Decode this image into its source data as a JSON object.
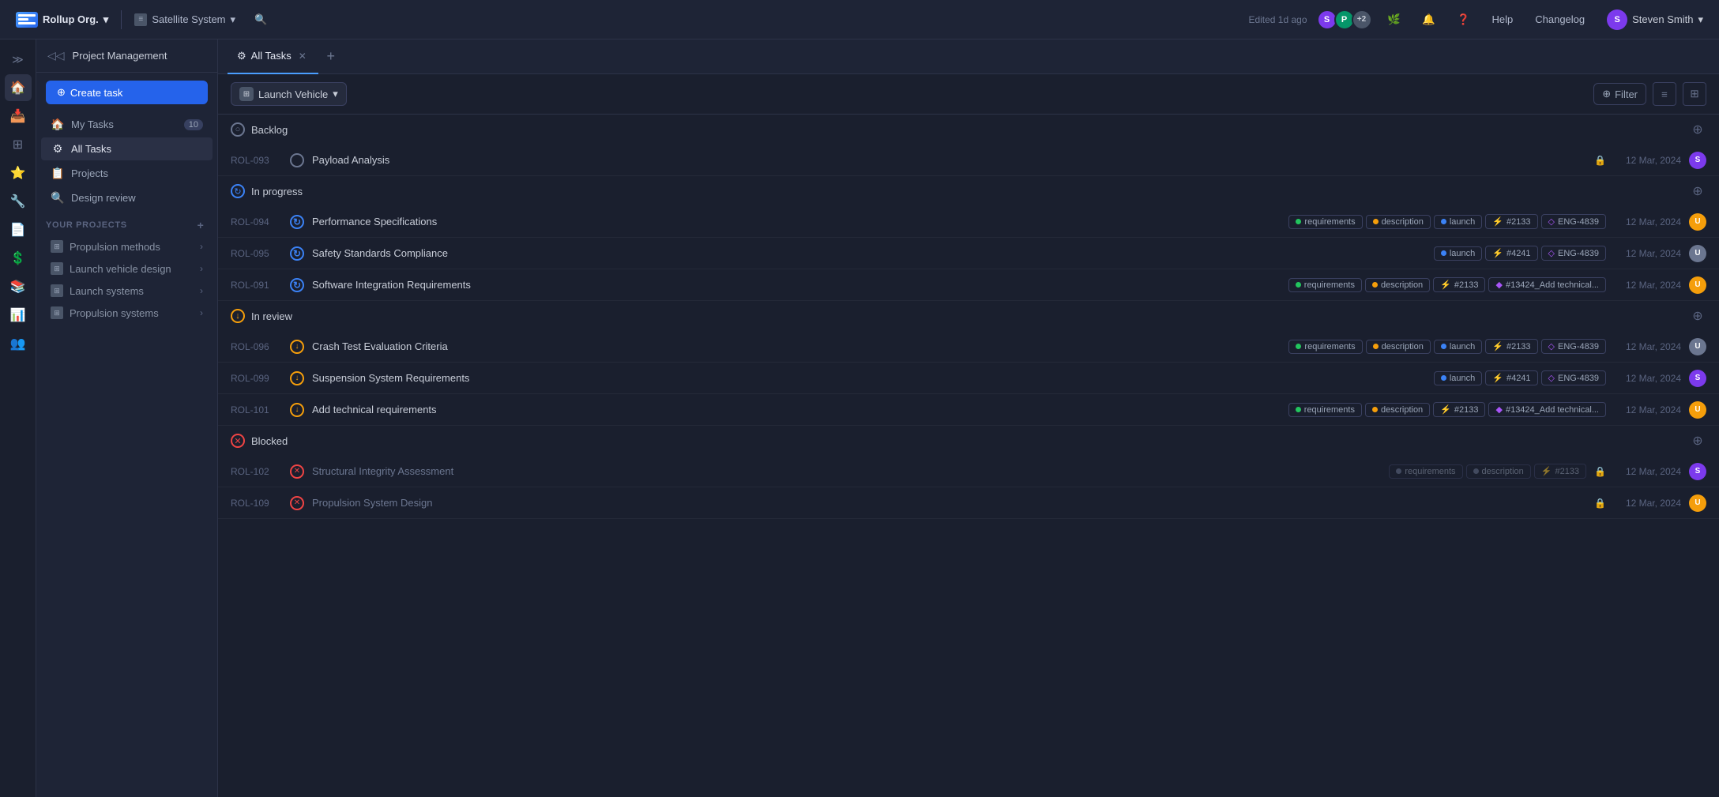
{
  "topbar": {
    "org_name": "Rollup Org.",
    "project_name": "Satellite System",
    "edited_text": "Edited 1d ago",
    "help_label": "Help",
    "changelog_label": "Changelog",
    "user_name": "Steven Smith",
    "user_initials": "S"
  },
  "left_panel": {
    "header_title": "Project Management",
    "create_task_label": "Create task",
    "nav": [
      {
        "icon": "🏠",
        "label": "My Tasks",
        "badge": "10",
        "id": "my-tasks"
      },
      {
        "icon": "⚙",
        "label": "All Tasks",
        "badge": "",
        "id": "all-tasks",
        "active": true
      },
      {
        "icon": "📋",
        "label": "Projects",
        "badge": "",
        "id": "projects"
      },
      {
        "icon": "🔍",
        "label": "Design review",
        "badge": "",
        "id": "design-review"
      }
    ],
    "projects_section_label": "YOUR PROJECTS",
    "projects": [
      {
        "label": "Propulsion methods",
        "id": "propulsion-methods"
      },
      {
        "label": "Launch vehicle design",
        "id": "launch-vehicle-design"
      },
      {
        "label": "Launch systems",
        "id": "launch-systems"
      },
      {
        "label": "Propulsion systems",
        "id": "propulsion-systems"
      }
    ]
  },
  "tabs": [
    {
      "label": "All Tasks",
      "active": true,
      "id": "all-tasks-tab"
    }
  ],
  "toolbar": {
    "group_label": "Launch Vehicle",
    "filter_label": "Filter"
  },
  "task_groups": [
    {
      "id": "backlog",
      "label": "Backlog",
      "status": "backlog",
      "tasks": [
        {
          "id": "ROL-093",
          "name": "Payload Analysis",
          "status": "backlog",
          "tags": [],
          "date": "12 Mar, 2024",
          "avatar": "S",
          "avatar_color": "#7c3aed",
          "has_lock": true
        }
      ]
    },
    {
      "id": "inprogress",
      "label": "In progress",
      "status": "inprogress",
      "tasks": [
        {
          "id": "ROL-094",
          "name": "Performance Specifications",
          "status": "inprogress",
          "tags": [
            {
              "type": "dot",
              "color": "green",
              "label": "requirements"
            },
            {
              "type": "dot",
              "color": "orange",
              "label": "description"
            },
            {
              "type": "dot",
              "color": "blue",
              "label": "launch"
            },
            {
              "type": "link",
              "color": "orange",
              "label": "#2133",
              "icon": "⚡"
            },
            {
              "type": "link",
              "color": "purple",
              "label": "ENG-4839",
              "icon": "◇"
            }
          ],
          "date": "12 Mar, 2024",
          "avatar": "U",
          "avatar_color": "#f59e0b"
        },
        {
          "id": "ROL-095",
          "name": "Safety Standards Compliance",
          "status": "inprogress",
          "tags": [
            {
              "type": "dot",
              "color": "blue",
              "label": "launch"
            },
            {
              "type": "link",
              "color": "orange",
              "label": "#4241",
              "icon": "⚡"
            },
            {
              "type": "link",
              "color": "purple",
              "label": "ENG-4839",
              "icon": "◇"
            }
          ],
          "date": "12 Mar, 2024",
          "avatar": "U2",
          "avatar_color": "#6b7690"
        },
        {
          "id": "ROL-091",
          "name": "Software Integration Requirements",
          "status": "inprogress",
          "tags": [
            {
              "type": "dot",
              "color": "green",
              "label": "requirements"
            },
            {
              "type": "dot",
              "color": "orange",
              "label": "description"
            },
            {
              "type": "link",
              "color": "orange",
              "label": "#2133",
              "icon": "⚡"
            },
            {
              "type": "link",
              "color": "diamond",
              "label": "#13424_Add technical...",
              "icon": "◆"
            }
          ],
          "date": "12 Mar, 2024",
          "avatar": "U3",
          "avatar_color": "#f59e0b"
        }
      ]
    },
    {
      "id": "review",
      "label": "In review",
      "status": "review",
      "tasks": [
        {
          "id": "ROL-096",
          "name": "Crash Test Evaluation Criteria",
          "status": "review",
          "tags": [
            {
              "type": "dot",
              "color": "green",
              "label": "requirements"
            },
            {
              "type": "dot",
              "color": "orange",
              "label": "description"
            },
            {
              "type": "dot",
              "color": "blue",
              "label": "launch"
            },
            {
              "type": "link",
              "color": "orange",
              "label": "#2133",
              "icon": "⚡"
            },
            {
              "type": "link",
              "color": "purple",
              "label": "ENG-4839",
              "icon": "◇"
            }
          ],
          "date": "12 Mar, 2024",
          "avatar": "U4",
          "avatar_color": "#6b7690"
        },
        {
          "id": "ROL-099",
          "name": "Suspension System Requirements",
          "status": "review",
          "tags": [
            {
              "type": "dot",
              "color": "blue",
              "label": "launch"
            },
            {
              "type": "link",
              "color": "orange",
              "label": "#4241",
              "icon": "⚡"
            },
            {
              "type": "link",
              "color": "purple",
              "label": "ENG-4839",
              "icon": "◇"
            }
          ],
          "date": "12 Mar, 2024",
          "avatar": "S",
          "avatar_color": "#7c3aed"
        },
        {
          "id": "ROL-101",
          "name": "Add technical requirements",
          "status": "review",
          "tags": [
            {
              "type": "dot",
              "color": "green",
              "label": "requirements"
            },
            {
              "type": "dot",
              "color": "orange",
              "label": "description"
            },
            {
              "type": "link",
              "color": "orange",
              "label": "#2133",
              "icon": "⚡"
            },
            {
              "type": "link",
              "color": "diamond",
              "label": "#13424_Add technical...",
              "icon": "◆"
            }
          ],
          "date": "12 Mar, 2024",
          "avatar": "U3",
          "avatar_color": "#f59e0b"
        }
      ]
    },
    {
      "id": "blocked",
      "label": "Blocked",
      "status": "blocked",
      "tasks": [
        {
          "id": "ROL-102",
          "name": "Structural Integrity Assessment",
          "status": "blocked",
          "tags": [
            {
              "type": "dot",
              "color": "gray",
              "label": "requirements"
            },
            {
              "type": "dot",
              "color": "gray",
              "label": "description"
            },
            {
              "type": "link",
              "color": "gray",
              "label": "#2133",
              "icon": "⚡"
            }
          ],
          "date": "12 Mar, 2024",
          "avatar": "S",
          "avatar_color": "#7c3aed",
          "muted": true,
          "has_lock": true
        },
        {
          "id": "ROL-109",
          "name": "Propulsion System Design",
          "status": "blocked",
          "tags": [],
          "date": "12 Mar, 2024",
          "avatar": "U5",
          "avatar_color": "#f59e0b",
          "muted": true,
          "has_lock": true
        }
      ]
    }
  ]
}
